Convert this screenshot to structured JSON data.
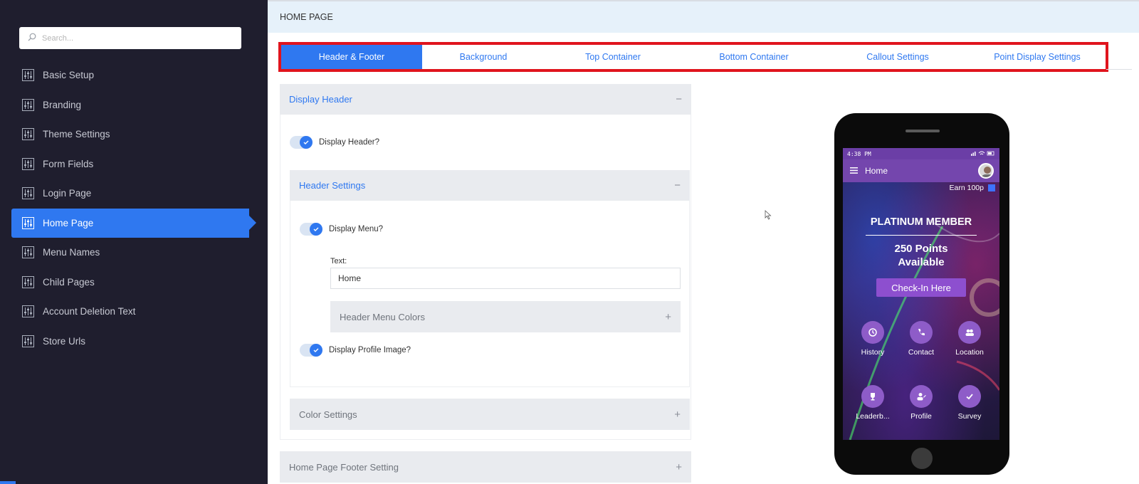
{
  "sidebar": {
    "search_placeholder": "Search...",
    "items": [
      {
        "label": "Basic Setup",
        "active": false
      },
      {
        "label": "Branding",
        "active": false
      },
      {
        "label": "Theme Settings",
        "active": false
      },
      {
        "label": "Form Fields",
        "active": false
      },
      {
        "label": "Login Page",
        "active": false
      },
      {
        "label": "Home Page",
        "active": true
      },
      {
        "label": "Menu Names",
        "active": false
      },
      {
        "label": "Child Pages",
        "active": false
      },
      {
        "label": "Account Deletion Text",
        "active": false
      },
      {
        "label": "Store Urls",
        "active": false
      }
    ]
  },
  "page": {
    "title": "HOME PAGE"
  },
  "tabs": [
    {
      "label": "Header & Footer",
      "active": true
    },
    {
      "label": "Background",
      "active": false
    },
    {
      "label": "Top Container",
      "active": false
    },
    {
      "label": "Bottom Container",
      "active": false
    },
    {
      "label": "Callout Settings",
      "active": false
    },
    {
      "label": "Point Display Settings",
      "active": false
    }
  ],
  "display_header": {
    "title": "Display Header",
    "toggle_label": "Display Header?",
    "toggle_on": true,
    "collapse_sign": "−"
  },
  "header_settings": {
    "title": "Header Settings",
    "collapse_sign": "−",
    "display_menu_label": "Display Menu?",
    "display_menu_on": true,
    "text_label": "Text:",
    "text_value": "Home",
    "menu_colors_title": "Header Menu Colors",
    "expand_sign": "+",
    "display_profile_label": "Display Profile Image?",
    "display_profile_on": true
  },
  "color_settings": {
    "title": "Color Settings",
    "expand_sign": "+"
  },
  "footer_setting": {
    "title": "Home Page Footer Setting",
    "expand_sign": "+"
  },
  "phone": {
    "time": "4:38 PM",
    "app_title": "Home",
    "earn": "Earn 100p",
    "tier": "PLATINUM MEMBER",
    "points_line1": "250 Points",
    "points_line2": "Available",
    "checkin": "Check-In Here",
    "icons": [
      {
        "label": "History",
        "icon": "history-icon"
      },
      {
        "label": "Contact",
        "icon": "phone-icon"
      },
      {
        "label": "Location",
        "icon": "users-icon"
      },
      {
        "label": "Leaderb...",
        "icon": "trophy-icon"
      },
      {
        "label": "Profile",
        "icon": "user-edit-icon"
      },
      {
        "label": "Survey",
        "icon": "check-icon"
      }
    ]
  },
  "colors": {
    "accent": "#2f78f0",
    "sidebar_bg": "#1f1e2e",
    "highlight_border": "#e0141d",
    "phone_bar": "#7446ad",
    "checkin_bg": "#8d4fcf"
  }
}
